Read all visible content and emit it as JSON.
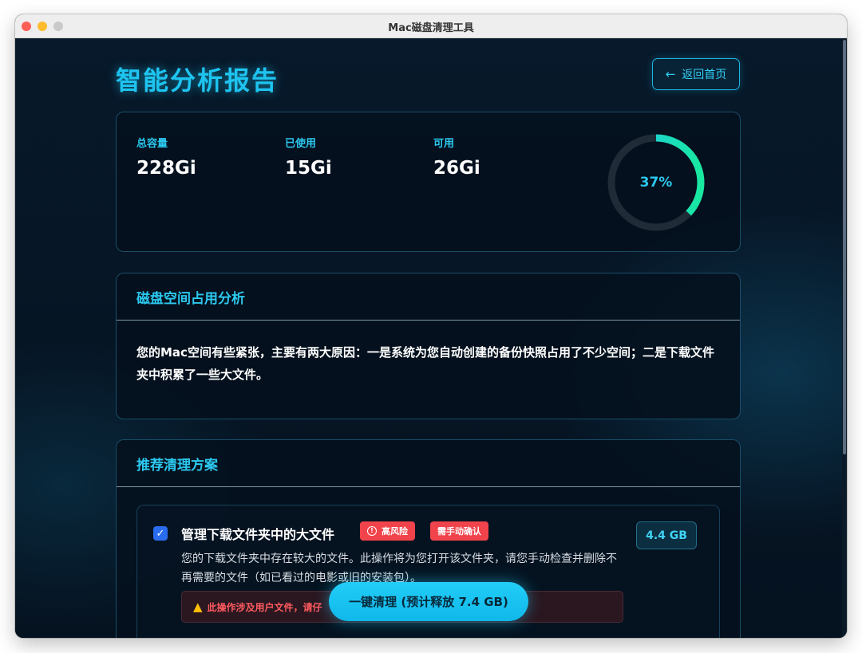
{
  "window": {
    "title": "Mac磁盘清理工具"
  },
  "header": {
    "title": "智能分析报告",
    "back_label": "返回首页"
  },
  "stats": {
    "total_label": "总容量",
    "total_value": "228Gi",
    "used_label": "已使用",
    "used_value": "15Gi",
    "free_label": "可用",
    "free_value": "26Gi",
    "usage_percent_text": "37%",
    "usage_fraction": 0.37,
    "ring_color_start": "#21c4f2",
    "ring_color_end": "#18e8a0"
  },
  "analysis": {
    "title": "磁盘空间占用分析",
    "text": "您的Mac空间有些紧张，主要有两大原因：一是系统为您自动创建的备份快照占用了不少空间；二是下载文件夹中积累了一些大文件。"
  },
  "plan": {
    "title": "推荐清理方案",
    "items": [
      {
        "checked": true,
        "title": "管理下载文件夹中的大文件",
        "risk_badge": "高风险",
        "manual_badge": "需手动确认",
        "size": "4.4 GB",
        "description": "您的下载文件夹中存在较大的文件。此操作将为您打开该文件夹，请您手动检查并删除不再需要的文件（如已看过的电影或旧的安装包）。",
        "warning": "此操作涉及用户文件，请仔"
      }
    ]
  },
  "actions": {
    "clean_label": "一键清理 (预计释放 7.4 GB)"
  },
  "colors": {
    "accent": "#1ec4f0",
    "danger": "#f1434b",
    "checkbox": "#2a6cf0"
  }
}
